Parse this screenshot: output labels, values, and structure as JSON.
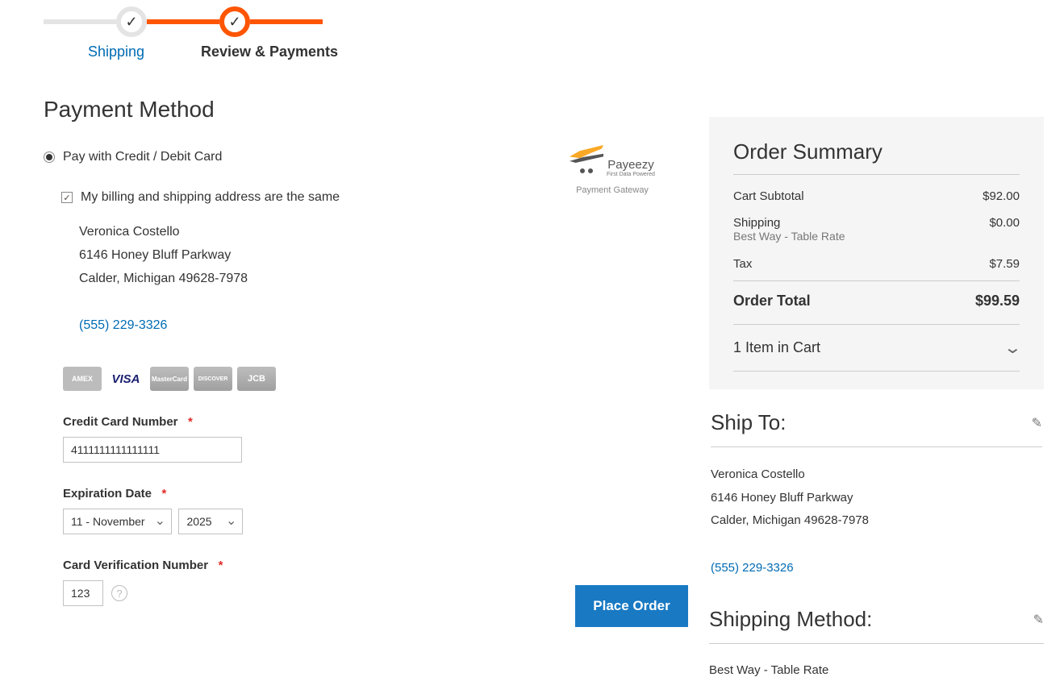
{
  "steps": {
    "s1": "Shipping",
    "s2": "Review & Payments"
  },
  "page_title": "Payment Method",
  "option": {
    "label": "Pay with Credit / Debit Card",
    "billing_same": "My billing and shipping address are the same",
    "addr": {
      "name": "Veronica Costello",
      "street": "6146 Honey Bluff Parkway",
      "city_line": "Calder, Michigan 49628-7978",
      "phone": "(555) 229-3326"
    }
  },
  "card_icons": {
    "amex": "AMEX",
    "visa": "VISA",
    "mc": "MasterCard",
    "disc": "DISCOVER",
    "jcb": "JCB"
  },
  "fields": {
    "cc_label": "Credit Card Number",
    "cc_value": "4111111111111111",
    "exp_label": "Expiration Date",
    "exp_month": "11 - November",
    "exp_year": "2025",
    "cvn_label": "Card Verification Number",
    "cvn_value": "123",
    "req": "*"
  },
  "gateway": {
    "brand": "Payeezy",
    "sub": "First Data Powered",
    "caption": "Payment Gateway"
  },
  "place_order": "Place Order",
  "summary": {
    "title": "Order Summary",
    "rows": {
      "subtotal_l": "Cart Subtotal",
      "subtotal_v": "$92.00",
      "shipping_l": "Shipping",
      "shipping_v": "$0.00",
      "shipping_sub": "Best Way - Table Rate",
      "tax_l": "Tax",
      "tax_v": "$7.59",
      "total_l": "Order Total",
      "total_v": "$99.59"
    },
    "cart_toggle": "1 Item in Cart"
  },
  "shipto": {
    "title": "Ship To:",
    "name": "Veronica Costello",
    "street": "6146 Honey Bluff Parkway",
    "city_line": "Calder, Michigan 49628-7978",
    "phone": "(555) 229-3326"
  },
  "shipmethod": {
    "title": "Shipping Method:",
    "value": "Best Way - Table Rate"
  }
}
